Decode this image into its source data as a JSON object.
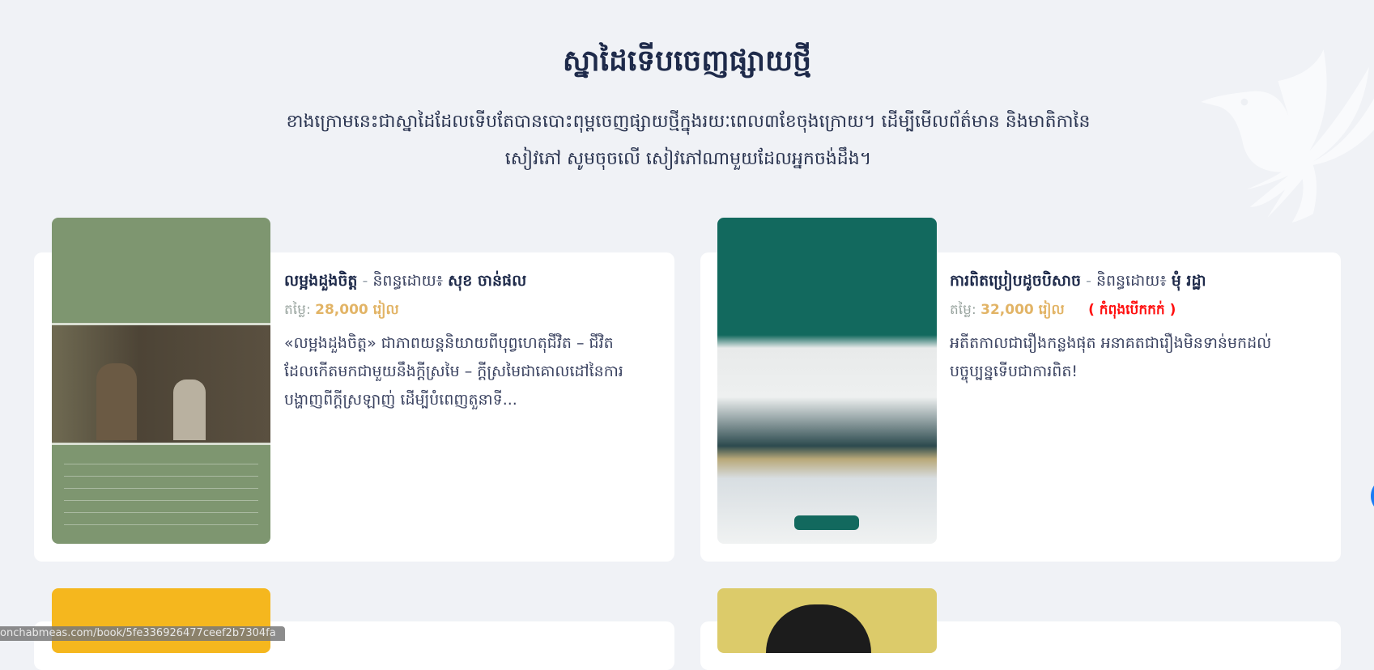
{
  "header": {
    "title": "ស្នាដៃទើបចេញផ្សាយថ្មី",
    "subtitle_line1": "ខាងក្រោមនេះជាស្នាដៃដែលទើបតែបានបោះពុម្ពចេញផ្សាយថ្មីក្នុងរយៈពេល៣ខែចុងក្រោយ។ ដើម្បីមើលព័ត៌មាន និងមាតិកានៃ",
    "subtitle_line2": "សៀវភៅ សូមចុចលើ សៀវភៅណាមួយដែលអ្នកចង់ដឹង។"
  },
  "books": [
    {
      "title": "លម្អងដួងចិត្ត",
      "separator": "-",
      "author_label": "និពន្ធដោយ៖",
      "author": "សុខ ចាន់ផល",
      "price_label": "តម្លៃ:",
      "price": "28,000 រៀល",
      "status": "",
      "description": "«លម្អងដួងចិត្ត» ជាភាពយន្តនិយាយពីបុព្វហេតុជីវិត – ជីវិតដែលកើតមកជាមួយនឹងក្ដីស្រមៃ – ក្ដីស្រមៃជាគោលដៅនៃការបង្ហាញពីក្ដីស្រឡាញ់ ដើម្បីបំពេញតួនាទី...",
      "cover_color": "#7e9670"
    },
    {
      "title": "ការពិតប្រៀបដូចបិសាច",
      "separator": "-",
      "author_label": "និពន្ធដោយ៖",
      "author": "មុំ រដ្ឋា",
      "price_label": "តម្លៃ:",
      "price": "32,000 រៀល",
      "status": "( កំពុងបើកកក់ )",
      "description": "អតីតកាលជារឿងកន្លងផុត អនាគតជារឿងមិនទាន់មកដល់ បច្ចុប្បន្នទើបជាការពិត!",
      "cover_color": "#12695e"
    }
  ],
  "status_bar": {
    "url": "onchabmeas.com/book/5fe336926477ceef2b7304fa"
  },
  "colors": {
    "background": "#f0f2f6",
    "title": "#1e2a4a",
    "price": "#e2b466",
    "status": "#ff1010",
    "fab": "#1a7cf5"
  }
}
